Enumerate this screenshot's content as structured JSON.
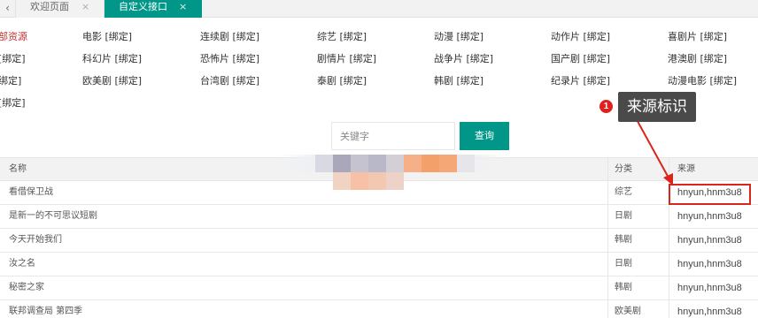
{
  "tabs": {
    "prev_icon": "‹",
    "welcome_label": "欢迎页面",
    "custom_label": "自定义接口",
    "close_icon": "×"
  },
  "categories": {
    "row1": [
      "部资源",
      "电影 [绑定]",
      "连续剧 [绑定]",
      "综艺 [绑定]",
      "动漫 [绑定]",
      "动作片 [绑定]",
      "喜剧片 [绑定]"
    ],
    "row2": [
      "[绑定]",
      "科幻片 [绑定]",
      "恐怖片 [绑定]",
      "剧情片 [绑定]",
      "战争片 [绑定]",
      "国产剧 [绑定]",
      "港澳剧 [绑定]"
    ],
    "row3": [
      "绑定]",
      "欧美剧 [绑定]",
      "台湾剧 [绑定]",
      "泰剧 [绑定]",
      "韩剧 [绑定]",
      "纪录片 [绑定]",
      "动漫电影 [绑定]"
    ],
    "row4": [
      "[绑定]"
    ]
  },
  "search": {
    "placeholder": "关键字",
    "button_label": "查询"
  },
  "table": {
    "headers": {
      "name": "名称",
      "category": "分类",
      "source": "来源"
    },
    "rows": [
      {
        "name": "看借保卫战",
        "category": "综艺",
        "source": "hnyun,hnm3u8"
      },
      {
        "name": "是新一的不可思议短剧",
        "category": "日剧",
        "source": "hnyun,hnm3u8"
      },
      {
        "name": "今天开始我们",
        "category": "韩剧",
        "source": "hnyun,hnm3u8"
      },
      {
        "name": "汝之名",
        "category": "日剧",
        "source": "hnyun,hnm3u8"
      },
      {
        "name": "秘密之家",
        "category": "韩剧",
        "source": "hnyun,hnm3u8"
      },
      {
        "name": "联邦调查局 第四季",
        "category": "欧美剧",
        "source": "hnyun,hnm3u8"
      }
    ]
  },
  "annotation": {
    "badge": "1",
    "label": "来源标识",
    "color": "#d9261c"
  },
  "colors": {
    "accent": "#009688",
    "active_category": "#c23531"
  }
}
